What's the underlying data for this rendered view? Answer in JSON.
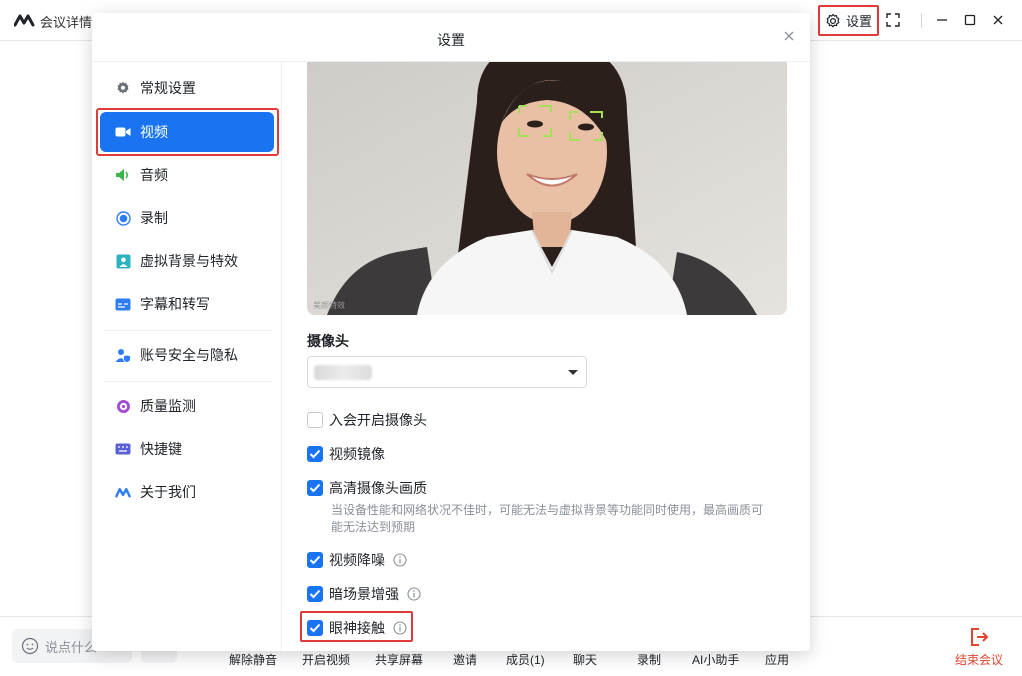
{
  "app": {
    "title": "会议详情",
    "settings_label": "设置"
  },
  "dialog": {
    "title": "设置"
  },
  "sidebar": {
    "items": [
      {
        "label": "常规设置",
        "icon": "gear-icon",
        "active": false
      },
      {
        "label": "视频",
        "icon": "video-icon",
        "active": true
      },
      {
        "label": "音频",
        "icon": "speaker-icon",
        "active": false
      },
      {
        "label": "录制",
        "icon": "record-icon",
        "active": false
      },
      {
        "label": "虚拟背景与特效",
        "icon": "portrait-icon",
        "active": false
      },
      {
        "label": "字幕和转写",
        "icon": "caption-icon",
        "active": false
      },
      {
        "label": "账号安全与隐私",
        "icon": "user-shield-icon",
        "active": false
      },
      {
        "label": "质量监测",
        "icon": "quality-icon",
        "active": false
      },
      {
        "label": "快捷键",
        "icon": "keyboard-icon",
        "active": false
      },
      {
        "label": "关于我们",
        "icon": "logo-icon",
        "active": false
      }
    ]
  },
  "video": {
    "preview_caption": "美颜特效",
    "camera_label": "摄像头",
    "options": [
      {
        "label": "入会开启摄像头",
        "checked": false,
        "info": false
      },
      {
        "label": "视频镜像",
        "checked": true,
        "info": false
      },
      {
        "label": "高清摄像头画质",
        "checked": true,
        "info": false
      },
      {
        "label": "视频降噪",
        "checked": true,
        "info": true
      },
      {
        "label": "暗场景增强",
        "checked": true,
        "info": true
      },
      {
        "label": "眼神接触",
        "checked": true,
        "info": true
      }
    ],
    "hd_hint": "当设备性能和网络状况不佳时，可能无法与虚拟背景等功能同时使用，最高画质可能无法达到预期"
  },
  "toolbar": {
    "chat_placeholder": "说点什么",
    "items": [
      "解除静音",
      "开启视频",
      "共享屏幕",
      "邀请",
      "成员(1)",
      "聊天",
      "录制",
      "AI小助手",
      "应用"
    ],
    "end_label": "结束会议"
  },
  "colors": {
    "accent": "#1a73f0",
    "highlight": "#e03a3a",
    "end": "#e0452f"
  }
}
